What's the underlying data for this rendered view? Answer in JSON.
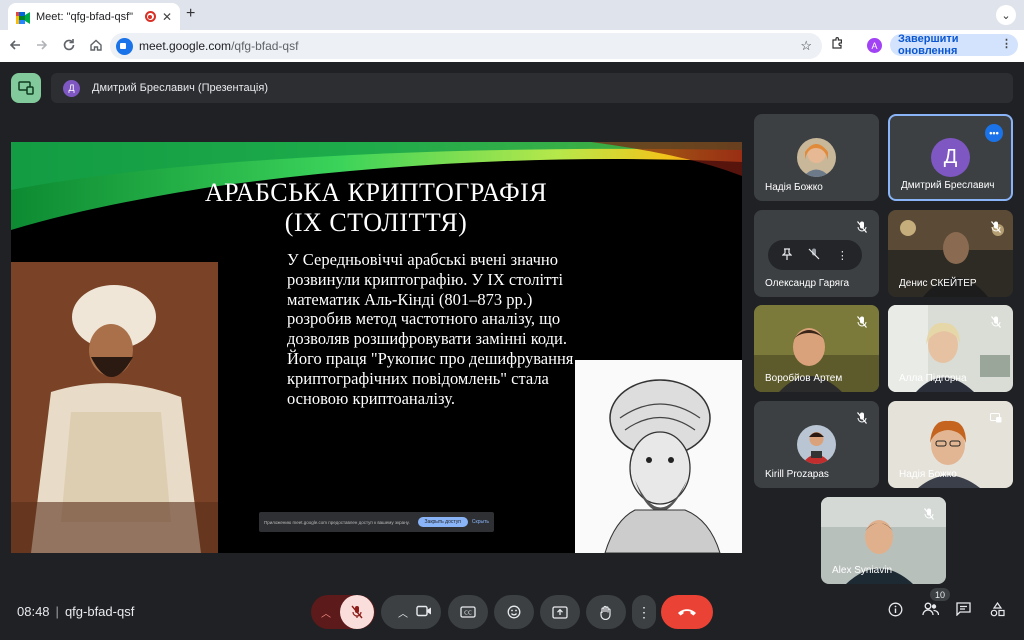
{
  "browser": {
    "tab_title": "Meet: \"qfg-bfad-qsf\"",
    "tab_close": "✕",
    "new_tab": "+",
    "tab_search": "⌄",
    "url_host": "meet.google.com",
    "url_path": "/qfg-bfad-qsf",
    "profile_letter": "A",
    "update_button": "Завершити оновлення",
    "menu": "⋮",
    "icons": [
      "back-arrow-icon",
      "forward-arrow-icon",
      "reload-icon",
      "home-icon",
      "star-icon",
      "extensions-icon"
    ]
  },
  "meet": {
    "presenter_letter": "Д",
    "presenter_label": "Дмитрий Бреславич (Презентація)"
  },
  "slide": {
    "title_line1": "АРАБСЬКА КРИПТОГРАФІЯ",
    "title_line2": "(IX СТОЛІТТЯ)",
    "body": "У Середньовіччі арабські вчені значно розвинули криптографію. У IX столітті математик Аль-Кінді (801–873 рр.) розробив метод частотного аналізу, що дозволяв розшифровувати замінні коди. Його праця \"Рукопис про дешифрування криптографічних повідомлень\" стала основою криптоаналізу.",
    "notify_text": "Приложению meet.google.com предоставлен доступ к вашему экрану.",
    "notify_button": "Закрыть доступ",
    "notify_link": "Скрыть"
  },
  "participants": [
    {
      "name": "Надія Божко",
      "type": "photo-avatar"
    },
    {
      "name": "Дмитрий Бреславич",
      "type": "letter",
      "letter": "Д",
      "active": true
    },
    {
      "name": "Олександр Гаряга",
      "type": "hover",
      "muted": true
    },
    {
      "name": "Денис СКЕЙТЕР",
      "type": "video",
      "muted": true
    },
    {
      "name": "Воробйов Артем",
      "type": "video",
      "muted": true
    },
    {
      "name": "Алла Підгорна",
      "type": "video",
      "muted": true
    },
    {
      "name": "Kirill Prozapas",
      "type": "photo-avatar",
      "muted": true
    },
    {
      "name": "Надія Божко",
      "type": "video",
      "presenting": true
    },
    {
      "name": "Alex Syniavin",
      "type": "video",
      "muted": true
    }
  ],
  "footer": {
    "time": "08:48",
    "meeting_code": "qfg-bfad-qsf",
    "participant_count": "10"
  },
  "colors": {
    "background": "#202124",
    "tile": "#3c4043",
    "accent": "#8ab4f8",
    "end_call": "#ea4335",
    "mic_off": "#f9dedc"
  }
}
